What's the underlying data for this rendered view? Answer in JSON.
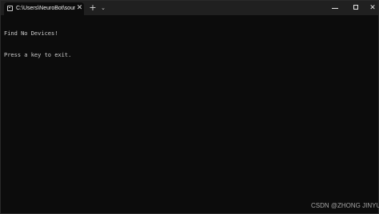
{
  "window": {
    "tab_title": "C:\\Users\\NeuroBot\\source\\repos",
    "tab_icon": "terminal-icon",
    "close_tab_symbol": "✕",
    "new_tab_symbol": "+",
    "dropdown_symbol": "⌄",
    "close_window_symbol": "✕"
  },
  "console": {
    "lines": [
      "Find No Devices!",
      "Press a key to exit."
    ]
  },
  "watermark": "CSDN @ZHONG JINYU",
  "colors": {
    "background": "#0c0c0c",
    "titlebar": "#202020",
    "text": "#cccccc"
  }
}
